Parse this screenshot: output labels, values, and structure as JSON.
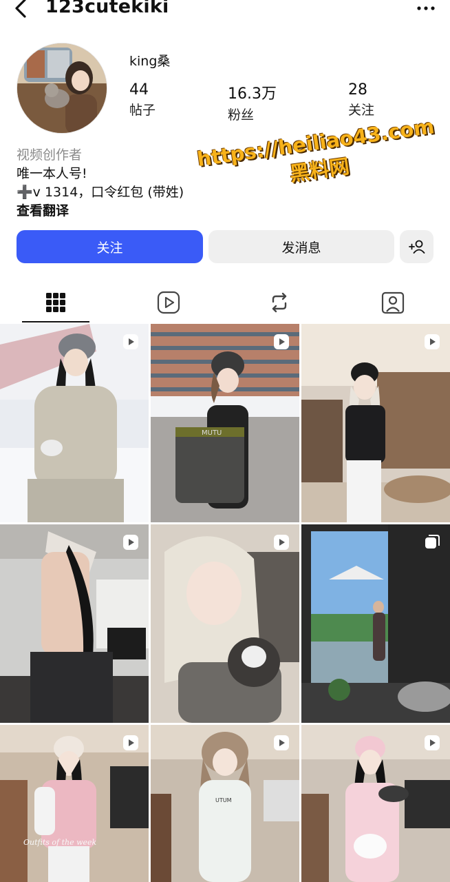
{
  "header": {
    "username": "123cutekiki",
    "back_icon": "chevron-left-icon",
    "more_icon": "more-horizontal-icon"
  },
  "profile": {
    "display_name": "king桑",
    "stats": [
      {
        "value": "44",
        "label": "帖子"
      },
      {
        "value": "16.3万",
        "label": "粉丝"
      },
      {
        "value": "28",
        "label": "关注"
      }
    ]
  },
  "bio": {
    "category": "视频创作者",
    "line1": "唯一本人号!",
    "line2": "➕v 1314，口令红包 (带姓)",
    "translate": "查看翻译"
  },
  "watermark": {
    "url": "https://heiliao43.com",
    "brand": "黑料网"
  },
  "actions": {
    "follow_label": "关注",
    "message_label": "发消息",
    "follow_color": "#3a5bf7"
  },
  "tabs": [
    {
      "icon": "grid-icon",
      "active": true
    },
    {
      "icon": "reels-icon",
      "active": false
    },
    {
      "icon": "reposts-icon",
      "active": false
    },
    {
      "icon": "tagged-icon",
      "active": false
    }
  ],
  "posts": [
    {
      "type": "reel",
      "overlay_text": ""
    },
    {
      "type": "reel",
      "overlay_text": "MUTU"
    },
    {
      "type": "reel",
      "overlay_text": ""
    },
    {
      "type": "reel",
      "overlay_text": ""
    },
    {
      "type": "reel",
      "overlay_text": ""
    },
    {
      "type": "carousel",
      "overlay_text": ""
    },
    {
      "type": "reel",
      "overlay_text": "Outfits of the week"
    },
    {
      "type": "reel",
      "overlay_text": "UTUM"
    },
    {
      "type": "reel",
      "overlay_text": ""
    }
  ]
}
